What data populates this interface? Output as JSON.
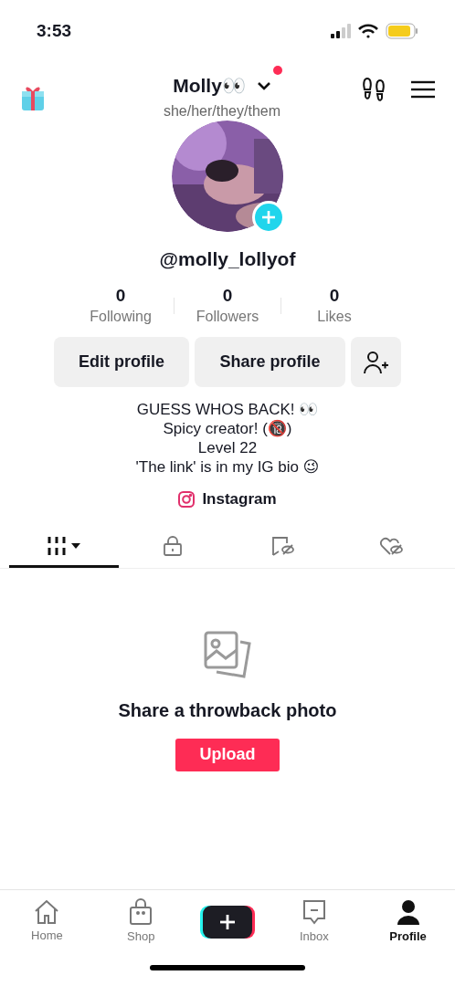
{
  "status_bar": {
    "time": "3:53"
  },
  "header": {
    "name": "Molly👀",
    "pronouns": "she/her/they/them",
    "notification": true
  },
  "profile": {
    "handle": "@molly_lollyof"
  },
  "stats": [
    {
      "value": "0",
      "label": "Following"
    },
    {
      "value": "0",
      "label": "Followers"
    },
    {
      "value": "0",
      "label": "Likes"
    }
  ],
  "buttons": [
    "Edit profile",
    "Share profile"
  ],
  "bio": [
    "GUESS WHOS BACK! 👀",
    "Spicy creator! (🔞)",
    "Level 22",
    "'The link' is in my IG bio 😉"
  ],
  "link": "Instagram",
  "tabs": [
    {
      "kind": "grid",
      "selected": true
    },
    {
      "kind": "lock",
      "selected": false
    },
    {
      "kind": "saved",
      "selected": false
    },
    {
      "kind": "liked",
      "selected": false
    }
  ],
  "empty_state": {
    "title": "Share a throwback photo",
    "button": "Upload"
  },
  "nav": [
    {
      "kind": "home",
      "label": "Home",
      "selected": false
    },
    {
      "kind": "shop",
      "label": "Shop",
      "selected": false
    },
    {
      "kind": "create"
    },
    {
      "kind": "inbox",
      "label": "Inbox",
      "selected": false
    },
    {
      "kind": "profile",
      "label": "Profile",
      "selected": true
    }
  ]
}
